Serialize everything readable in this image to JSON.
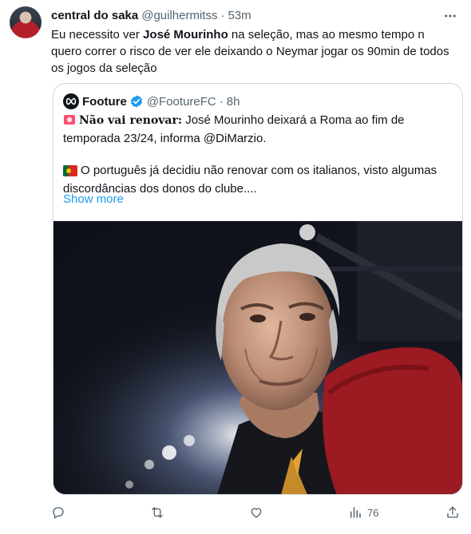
{
  "author": {
    "display_name": "central do saka",
    "handle": "@guilhermitss",
    "separator": "·",
    "time": "53m"
  },
  "tweet": {
    "text_part1": "Eu necessito ver ",
    "text_bold": "José Mourinho",
    "text_part2": " na seleção, mas ao mesmo tempo n quero correr o risco de ver ele deixando o Neymar jogar os 90min de todos os jogos da seleção"
  },
  "quote": {
    "display_name": "Footure",
    "handle": "@FootureFC",
    "separator": "·",
    "time": "8h",
    "emoji_1": "🚨",
    "bold_label": "Não vai renovar:",
    "line1_rest": " José Mourinho deixará a Roma ao fim de temporada 23/24, informa @DiMarzio.",
    "emoji_2": "🇵🇹",
    "line2": "O português já decidiu não renovar com os italianos, visto algumas discordâncias dos donos do clube....",
    "show_more": "Show more"
  },
  "actions": {
    "reply_count": "",
    "retweet_count": "",
    "like_count": "",
    "views_count": "76"
  },
  "icons": [
    "more-icon",
    "verified-icon",
    "reply-icon",
    "retweet-icon",
    "like-icon",
    "views-icon",
    "share-icon"
  ],
  "colors": {
    "text": "#0f1419",
    "secondary": "#536471",
    "link": "#1d9bf0",
    "border": "#cfd9de",
    "verified": "#1d9bf0"
  }
}
